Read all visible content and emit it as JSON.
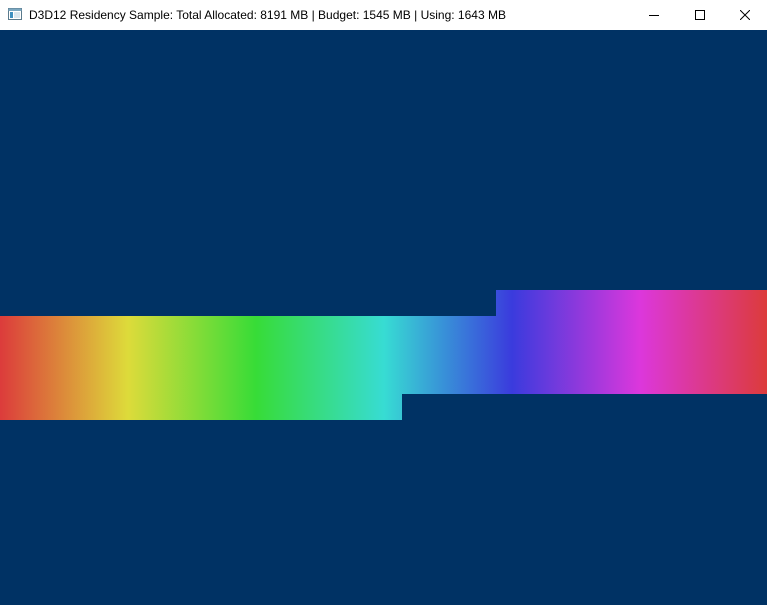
{
  "window": {
    "title": "D3D12 Residency Sample: Total Allocated: 8191 MB | Budget: 1545 MB | Using: 1643 MB",
    "controls": {
      "minimize_icon": "minimize-icon",
      "maximize_icon": "maximize-icon",
      "close_icon": "close-icon"
    }
  },
  "colors": {
    "client_background": "#003264",
    "titlebar_background": "#ffffff",
    "gradient": [
      "#dc3b3b",
      "#dddb3a",
      "#37dc37",
      "#37dcd3",
      "#3a3bdd",
      "#dc37dc",
      "#dc3b3b"
    ]
  }
}
